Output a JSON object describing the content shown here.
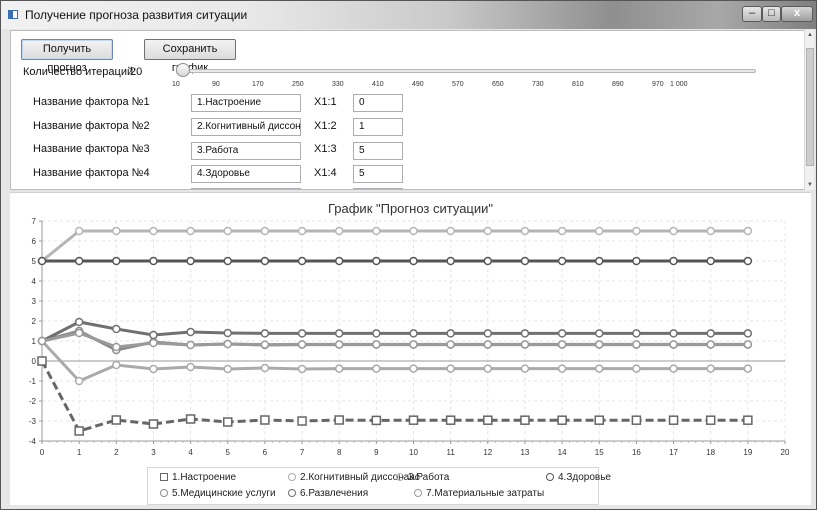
{
  "window": {
    "title": "Получение прогноза развития ситуации",
    "min": "–",
    "max": "□",
    "close": "x"
  },
  "toolbar": {
    "forecast_label": "Получить прогноз",
    "save_label": "Сохранить график"
  },
  "iterations": {
    "label": "Количество итераций:",
    "value": "20",
    "ticks": [
      "10",
      "90",
      "170",
      "250",
      "330",
      "410",
      "490",
      "570",
      "650",
      "730",
      "810",
      "890",
      "970",
      "1 000"
    ]
  },
  "factors": [
    {
      "label": "Название фактора №1",
      "name": "1.Настроение",
      "code": "X1:1",
      "value": "0"
    },
    {
      "label": "Название фактора №2",
      "name": "2.Когнитивный диссонан",
      "code": "X1:2",
      "value": "1"
    },
    {
      "label": "Название фактора №3",
      "name": "3.Работа",
      "code": "X1:3",
      "value": "5"
    },
    {
      "label": "Название фактора №4",
      "name": "4.Здоровье",
      "code": "X1:4",
      "value": "5"
    }
  ],
  "chart_data": {
    "type": "line",
    "title": "График \"Прогноз ситуации\"",
    "xlabel": "",
    "ylabel": "",
    "xlim": [
      0,
      20
    ],
    "ylim": [
      -4,
      7
    ],
    "xticks": [
      0,
      1,
      2,
      3,
      4,
      5,
      6,
      7,
      8,
      9,
      10,
      11,
      12,
      13,
      14,
      15,
      16,
      17,
      18,
      19,
      20
    ],
    "yticks": [
      -4,
      -3,
      -2,
      -1,
      0,
      1,
      2,
      3,
      4,
      5,
      6,
      7
    ],
    "grid": true,
    "legend_position": "bottom",
    "x": [
      0,
      1,
      2,
      3,
      4,
      5,
      6,
      7,
      8,
      9,
      10,
      11,
      12,
      13,
      14,
      15,
      16,
      17,
      18,
      19
    ],
    "series": [
      {
        "name": "1.Настроение",
        "marker": "square",
        "dashed": true,
        "color": "#666666",
        "values": [
          0,
          -3.5,
          -2.95,
          -3.15,
          -2.9,
          -3.05,
          -2.95,
          -3.0,
          -2.95,
          -2.97,
          -2.96,
          -2.96,
          -2.96,
          -2.96,
          -2.96,
          -2.96,
          -2.96,
          -2.96,
          -2.96,
          -2.96
        ]
      },
      {
        "name": "2.Когнитивный диссонанс",
        "marker": "circle",
        "color": "#aaaaaa",
        "values": [
          1,
          -1.0,
          -0.2,
          -0.4,
          -0.3,
          -0.4,
          -0.35,
          -0.4,
          -0.38,
          -0.38,
          -0.38,
          -0.38,
          -0.38,
          -0.38,
          -0.38,
          -0.38,
          -0.38,
          -0.38,
          -0.38,
          -0.38
        ]
      },
      {
        "name": "3.Работа",
        "marker": "circle",
        "color": "#b5b5b5",
        "values": [
          5,
          6.5,
          6.5,
          6.5,
          6.5,
          6.5,
          6.5,
          6.5,
          6.5,
          6.5,
          6.5,
          6.5,
          6.5,
          6.5,
          6.5,
          6.5,
          6.5,
          6.5,
          6.5,
          6.5
        ]
      },
      {
        "name": "4.Здоровье",
        "marker": "circle",
        "color": "#555555",
        "values": [
          5,
          5,
          5,
          5,
          5,
          5,
          5,
          5,
          5,
          5,
          5,
          5,
          5,
          5,
          5,
          5,
          5,
          5,
          5,
          5
        ]
      },
      {
        "name": "5.Медицинские услуги",
        "marker": "circle",
        "color": "#8a8a8a",
        "values": [
          1,
          1.5,
          0.55,
          0.95,
          0.8,
          0.85,
          0.8,
          0.82,
          0.82,
          0.82,
          0.82,
          0.82,
          0.82,
          0.82,
          0.82,
          0.82,
          0.82,
          0.82,
          0.82,
          0.82
        ]
      },
      {
        "name": "6.Развлечения",
        "marker": "circle",
        "color": "#707070",
        "values": [
          1,
          1.95,
          1.6,
          1.3,
          1.45,
          1.4,
          1.38,
          1.38,
          1.38,
          1.38,
          1.38,
          1.38,
          1.38,
          1.38,
          1.38,
          1.38,
          1.38,
          1.38,
          1.38,
          1.38
        ]
      },
      {
        "name": "7.Материальные затраты",
        "marker": "circle",
        "color": "#9a9a9a",
        "values": [
          1,
          1.4,
          0.7,
          0.9,
          0.8,
          0.85,
          0.82,
          0.83,
          0.83,
          0.83,
          0.83,
          0.83,
          0.83,
          0.83,
          0.83,
          0.83,
          0.83,
          0.83,
          0.83,
          0.83
        ]
      }
    ]
  }
}
